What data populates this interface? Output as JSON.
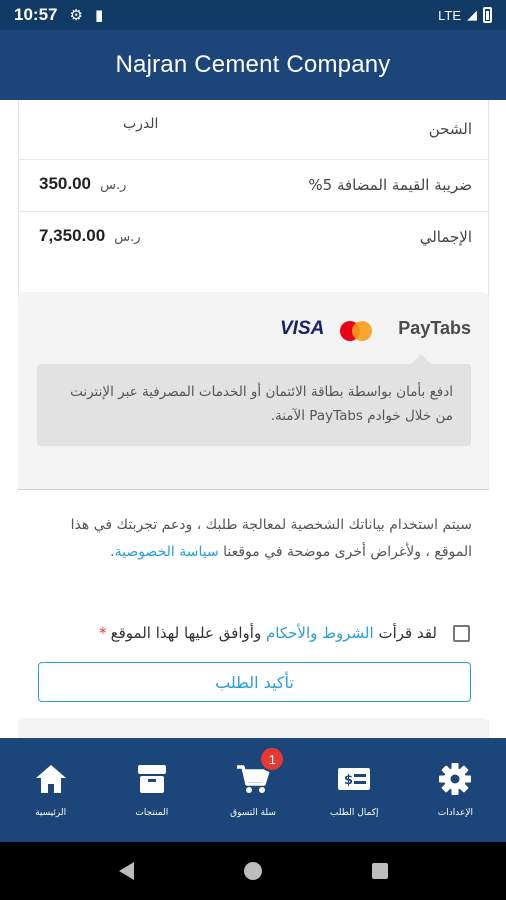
{
  "status_bar": {
    "time": "10:57",
    "network": "LTE"
  },
  "app_bar": {
    "title": "Najran Cement Company"
  },
  "order_summary": {
    "shipping_label": "الشحن",
    "shipping_value": "الدرب",
    "vat_label": "ضريبة القيمة المضافة 5%",
    "vat_amount": "350.00",
    "total_label": "الإجمالي",
    "total_amount": "7,350.00",
    "currency": "ر.س"
  },
  "payment": {
    "provider": "PayTabs",
    "card_brands": [
      "VISA",
      "mastercard"
    ],
    "description": "ادفع بأمان بواسطة بطاقة الائتمان أو الخدمات المصرفية عبر الإنترنت من خلال خوادم PayTabs الآمنة."
  },
  "privacy": {
    "text": "سيتم استخدام بياناتك الشخصية لمعالجة طلبك ، ودعم تجربتك في هذا الموقع ، ولأغراض أخرى موضحة في موقعنا",
    "link": "سياسة الخصوصية",
    "end": "."
  },
  "terms": {
    "prefix": "لقد قرأت",
    "link": "الشروط والأحكام",
    "suffix": "وأوافق عليها لهذا الموقع",
    "required_mark": "*",
    "checked": false
  },
  "confirm_button": "تأكيد الطلب",
  "bottom_nav": {
    "items": [
      {
        "label": "الرئيسية",
        "icon": "home-icon"
      },
      {
        "label": "المنتجات",
        "icon": "box-icon"
      },
      {
        "label": "سلة التسوق",
        "icon": "cart-icon",
        "badge": "1"
      },
      {
        "label": "إكمال الطلب",
        "icon": "payment-icon"
      },
      {
        "label": "الإعدادات",
        "icon": "gear-icon"
      }
    ]
  },
  "colors": {
    "primary": "#1c467a",
    "status_bar": "#123a66",
    "accent": "#2a9fd8",
    "badge": "#e53935"
  }
}
